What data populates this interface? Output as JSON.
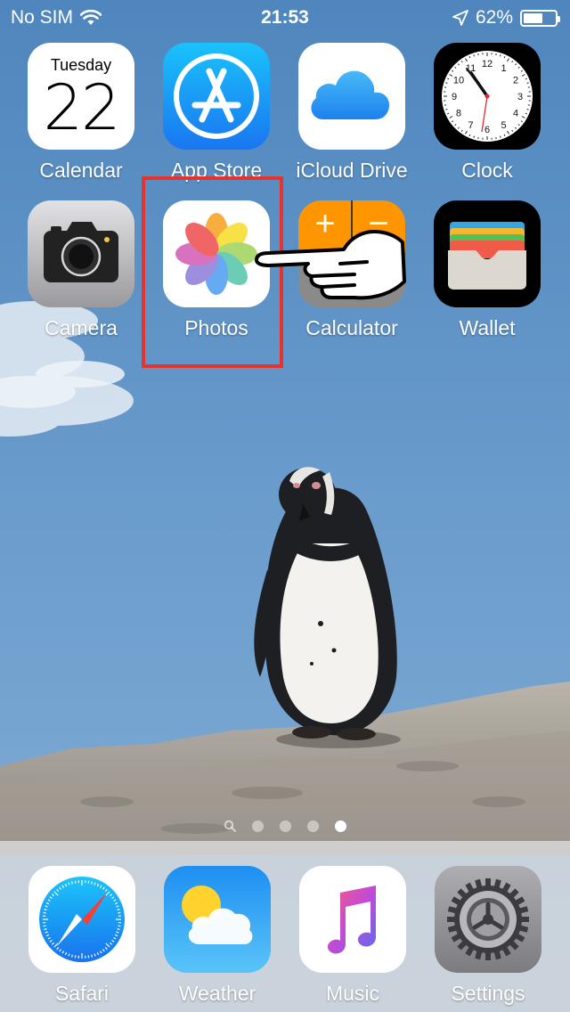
{
  "status_bar": {
    "carrier": "No SIM",
    "time": "21:53",
    "battery": "62%",
    "battery_level": 0.62
  },
  "calendar": {
    "day": "Tuesday",
    "date": "22"
  },
  "apps": {
    "calendar": "Calendar",
    "app_store": "App Store",
    "icloud_drive": "iCloud Drive",
    "clock": "Clock",
    "camera": "Camera",
    "photos": "Photos",
    "calculator": "Calculator",
    "wallet": "Wallet"
  },
  "clock_face": {
    "numbers": [
      "12",
      "1",
      "2",
      "3",
      "4",
      "5",
      "6",
      "7",
      "8",
      "9",
      "10",
      "11"
    ]
  },
  "calculator_keys": {
    "plus": "+",
    "minus": "−"
  },
  "dock": {
    "safari": "Safari",
    "weather": "Weather",
    "music": "Music",
    "settings": "Settings"
  },
  "page_indicator": {
    "pages": 4,
    "current": 4
  },
  "annotation": {
    "highlighted_app": "Photos",
    "highlight_color": "#e8332d",
    "pointer_icon": "hand-pointer-icon"
  },
  "colors": {
    "sky": "#5d92c4",
    "app_store": "#1a8cf2",
    "settings": "#8e8e93"
  }
}
